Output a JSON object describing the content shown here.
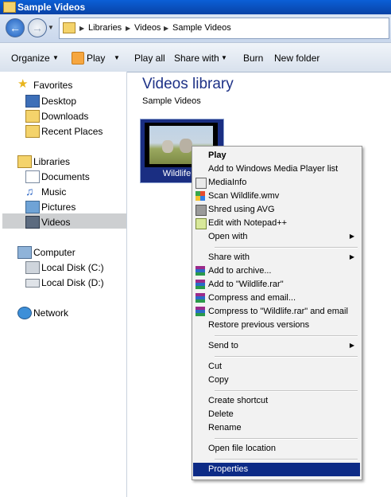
{
  "window": {
    "title": "Sample Videos"
  },
  "address": {
    "crumbs": [
      "Libraries",
      "Videos",
      "Sample Videos"
    ]
  },
  "toolbar": {
    "organize": "Organize",
    "play": "Play",
    "play_all": "Play all",
    "share_with": "Share with",
    "burn": "Burn",
    "new_folder": "New folder"
  },
  "nav": {
    "favorites": {
      "label": "Favorites",
      "items": [
        "Desktop",
        "Downloads",
        "Recent Places"
      ]
    },
    "libraries": {
      "label": "Libraries",
      "items": [
        "Documents",
        "Music",
        "Pictures",
        "Videos"
      ]
    },
    "computer": {
      "label": "Computer",
      "items": [
        "Local Disk (C:)",
        "Local Disk (D:)"
      ]
    },
    "network": {
      "label": "Network"
    }
  },
  "library": {
    "title": "Videos library",
    "subtitle": "Sample Videos"
  },
  "file": {
    "name": "Wildlife.wmv",
    "caption_visible": "Wildlife.w"
  },
  "context_menu": {
    "items": [
      {
        "label": "Play",
        "icon": ""
      },
      {
        "label": "Add to Windows Media Player list",
        "icon": ""
      },
      {
        "label": "MediaInfo",
        "icon": "mediainfo-icon"
      },
      {
        "label": "Scan Wildlife.wmv",
        "icon": "avg-scan-icon"
      },
      {
        "label": "Shred using AVG",
        "icon": "shred-icon"
      },
      {
        "label": "Edit with Notepad++",
        "icon": "notepadpp-icon"
      },
      {
        "label": "Open with",
        "icon": ""
      },
      {
        "label": "Share with",
        "icon": ""
      },
      {
        "label": "Add to archive...",
        "icon": "winrar-icon"
      },
      {
        "label": "Add to \"Wildlife.rar\"",
        "icon": "winrar-icon"
      },
      {
        "label": "Compress and email...",
        "icon": "winrar-icon"
      },
      {
        "label": "Compress to \"Wildlife.rar\" and email",
        "icon": "winrar-icon"
      },
      {
        "label": "Restore previous versions",
        "icon": ""
      },
      {
        "label": "Send to",
        "icon": ""
      },
      {
        "label": "Cut",
        "icon": ""
      },
      {
        "label": "Copy",
        "icon": ""
      },
      {
        "label": "Create shortcut",
        "icon": ""
      },
      {
        "label": "Delete",
        "icon": ""
      },
      {
        "label": "Rename",
        "icon": ""
      },
      {
        "label": "Open file location",
        "icon": ""
      },
      {
        "label": "Properties",
        "icon": ""
      }
    ],
    "highlighted": "Properties"
  },
  "colors": {
    "title_bar": "#0b5fd6",
    "menu_highlight": "#0d2b86",
    "library_title": "#1e3287",
    "selection_border": "#1a2e82"
  }
}
